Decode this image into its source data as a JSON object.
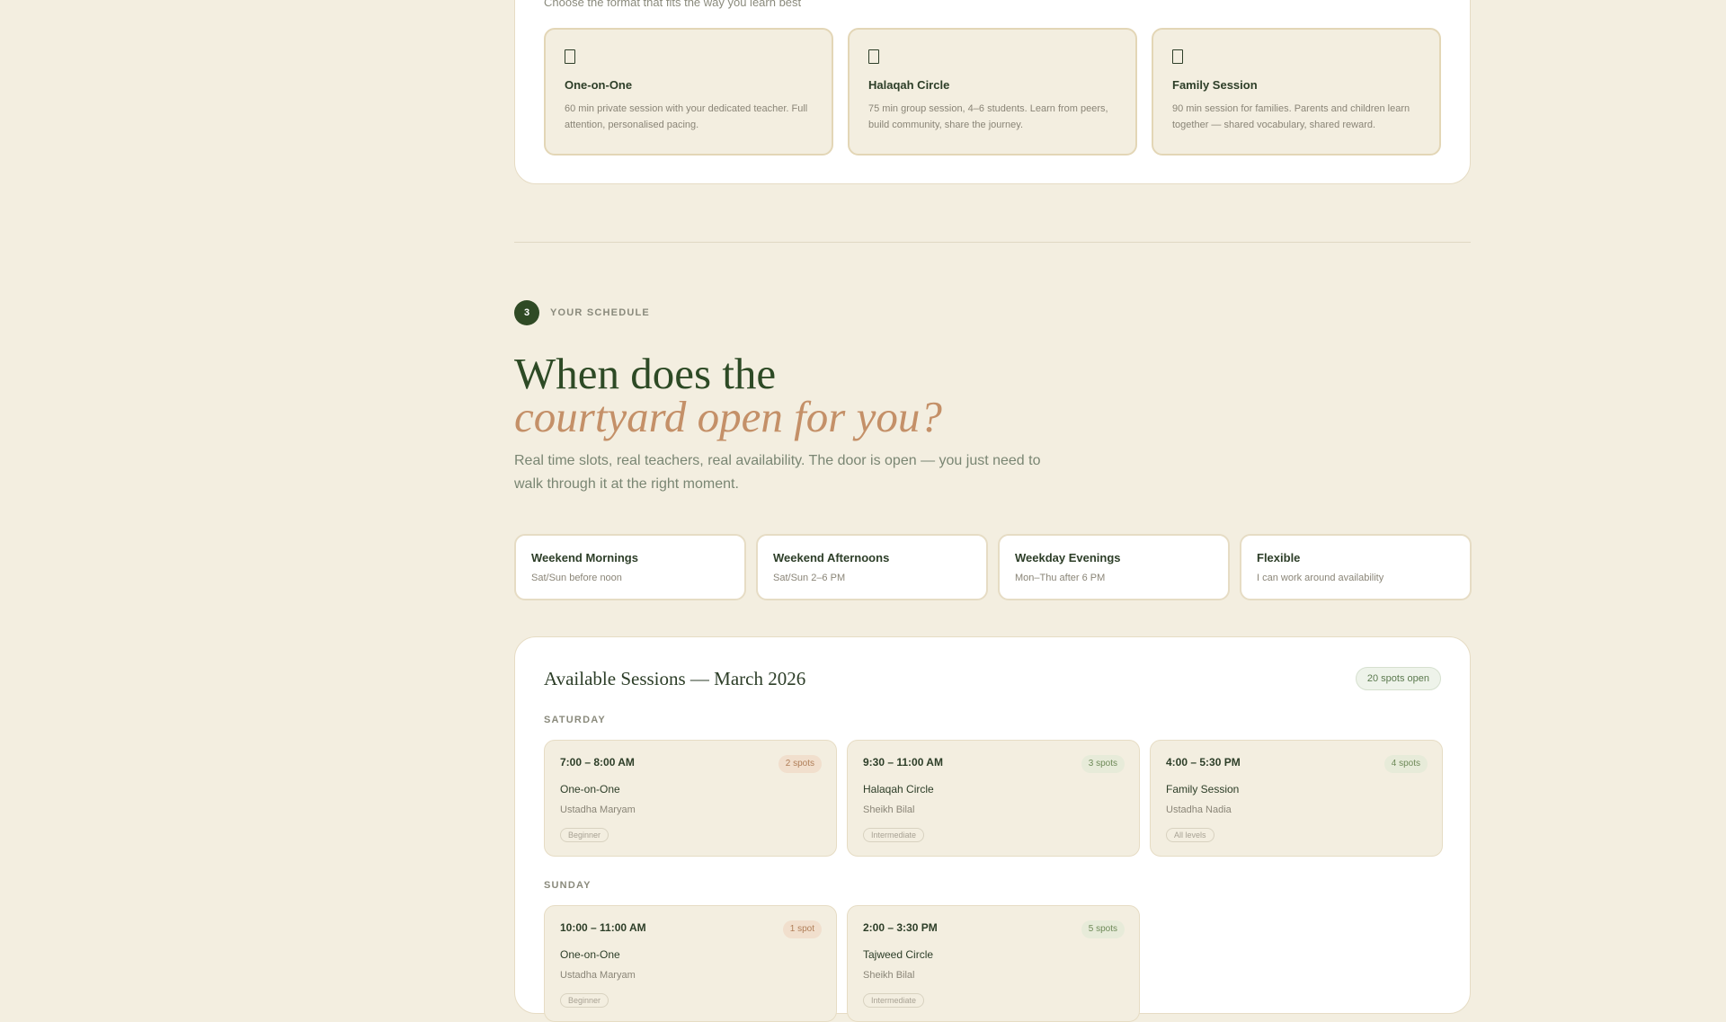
{
  "formats": {
    "intro": "Choose the format that fits the way you learn best",
    "cards": [
      {
        "icon": "person-icon",
        "title": "One-on-One",
        "desc": "60 min private session with your dedicated teacher. Full attention, personalised pacing."
      },
      {
        "icon": "group-icon",
        "title": "Halaqah Circle",
        "desc": "75 min group session, 4–6 students. Learn from peers, build community, share the journey."
      },
      {
        "icon": "family-icon",
        "title": "Family Session",
        "desc": "90 min session for families. Parents and children learn together — shared vocabulary, shared reward."
      }
    ]
  },
  "step": {
    "number": "3",
    "label": "YOUR SCHEDULE",
    "headline_line1": "When does the",
    "headline_line2": "courtyard open for you?",
    "lead": "Real time slots, real teachers, real availability. The door is open — you just need to walk through it at the right moment."
  },
  "preferences": [
    {
      "title": "Weekend Mornings",
      "sub": "Sat/Sun before noon"
    },
    {
      "title": "Weekend Afternoons",
      "sub": "Sat/Sun 2–6 PM"
    },
    {
      "title": "Weekday Evenings",
      "sub": "Mon–Thu after 6 PM"
    },
    {
      "title": "Flexible",
      "sub": "I can work around availability"
    }
  ],
  "sessions": {
    "title": "Available Sessions — March 2026",
    "spots_open": "20 spots open",
    "days": [
      {
        "label": "SATURDAY",
        "slots": [
          {
            "time": "7:00 – 8:00 AM",
            "spots": "2 spots",
            "type": "One-on-One",
            "teacher": "Ustadha Maryam",
            "level": "Beginner"
          },
          {
            "time": "9:30 – 11:00 AM",
            "spots": "3 spots",
            "type": "Halaqah Circle",
            "teacher": "Sheikh Bilal",
            "level": "Intermediate"
          },
          {
            "time": "4:00 – 5:30 PM",
            "spots": "4 spots",
            "type": "Family Session",
            "teacher": "Ustadha Nadia",
            "level": "All levels"
          }
        ]
      },
      {
        "label": "SUNDAY",
        "slots": [
          {
            "time": "10:00 – 11:00 AM",
            "spots": "1 spot",
            "type": "One-on-One",
            "teacher": "Ustadha Maryam",
            "level": "Beginner"
          },
          {
            "time": "2:00 – 3:30 PM",
            "spots": "5 spots",
            "type": "Tajweed Circle",
            "teacher": "Sheikh Bilal",
            "level": "Intermediate"
          }
        ]
      }
    ]
  },
  "colors": {
    "background": "#f3eee0",
    "primary_green": "#2f4a25",
    "accent_terracotta": "#c49068"
  }
}
